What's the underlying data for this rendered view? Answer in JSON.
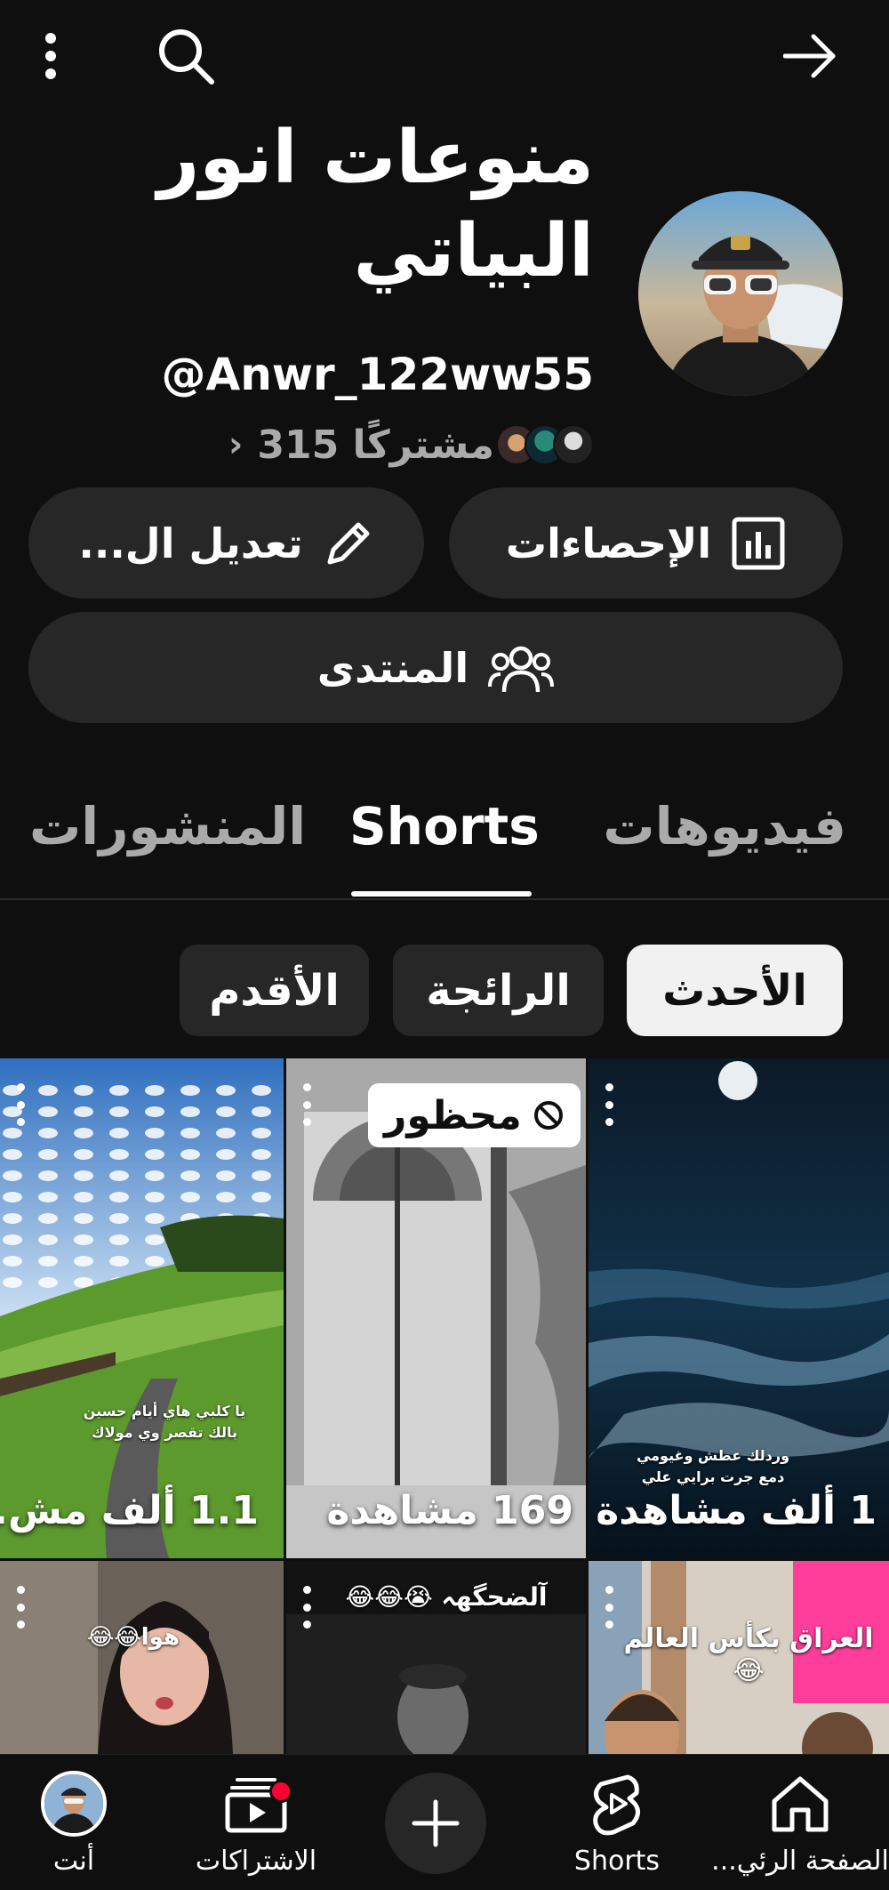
{
  "top_bar": {
    "icons": [
      "more-vert-icon",
      "search-icon",
      "arrow-forward-icon"
    ]
  },
  "channel": {
    "name_line1": "منوعات انور",
    "name_line2": "البياتي",
    "handle": "@Anwr_122ww55",
    "subscribers": "315 مشتركًا",
    "subscribers_chevron": "›"
  },
  "buttons": {
    "analytics": "الإحصاءات",
    "edit": "تعديل ال...",
    "community": "المنتدى"
  },
  "tabs": [
    {
      "label": "فيديوهات",
      "active": false
    },
    {
      "label": "Shorts",
      "active": true
    },
    {
      "label": "المنشورات",
      "active": false
    }
  ],
  "chips": [
    {
      "label": "الأحدث",
      "selected": true
    },
    {
      "label": "الرائجة",
      "selected": false
    },
    {
      "label": "الأقدم",
      "selected": false
    }
  ],
  "shorts": [
    {
      "views": "1 ألف مشاهدة",
      "caption": "وردلك عطش وغيومي\nدمع جرت برايي علي"
    },
    {
      "views": "169 مشاهدة",
      "badge": "محظور"
    },
    {
      "views": "1.1 ألف مش...",
      "caption": "يا كلبي هاي أيام حسين\nبالك تقصر وي مولاك"
    },
    {
      "caption": "العراق بكأس العالم 😂"
    },
    {
      "caption": "آلضحگهہ 😭😂😂"
    },
    {
      "caption": "هوا😂😂"
    }
  ],
  "bottom_nav": [
    {
      "label": "الصفحة الرئي...",
      "icon": "home-icon"
    },
    {
      "label": "Shorts",
      "icon": "shorts-icon"
    },
    {
      "label": "",
      "icon": "plus-icon"
    },
    {
      "label": "الاشتراكات",
      "icon": "subscriptions-icon"
    },
    {
      "label": "أنت",
      "icon": "avatar-icon"
    }
  ],
  "colors": {
    "background": "#0f0f0f",
    "surface": "#272727",
    "text_secondary": "#aaaaaa",
    "notification": "#ff0033"
  }
}
